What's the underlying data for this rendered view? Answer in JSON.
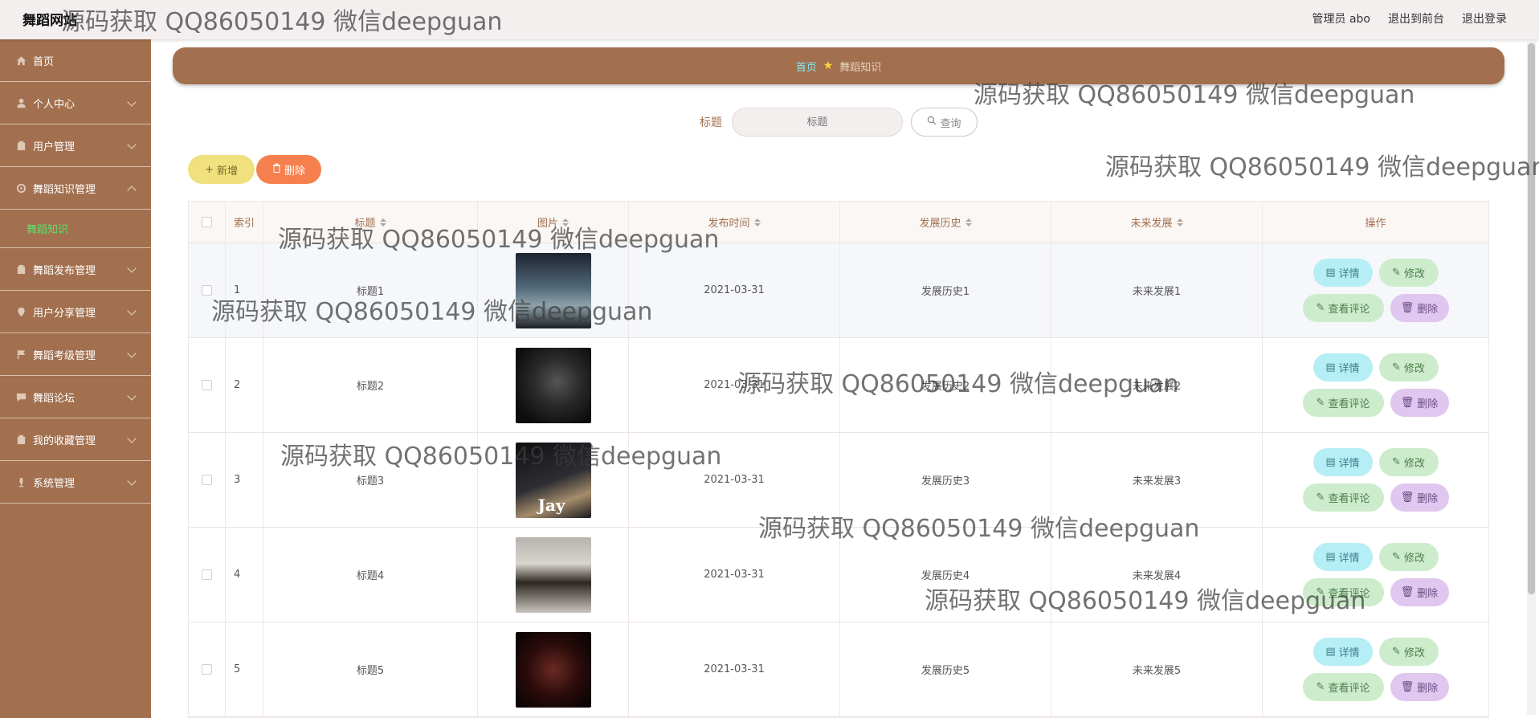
{
  "header": {
    "brand": "舞蹈网站",
    "admin_label": "管理员 abo",
    "back_front_label": "退出到前台",
    "logout_label": "退出登录"
  },
  "sidebar": {
    "items": [
      {
        "label": "首页",
        "icon": "home-icon"
      },
      {
        "label": "个人中心",
        "icon": "user-icon"
      },
      {
        "label": "用户管理",
        "icon": "box-icon"
      },
      {
        "label": "舞蹈知识管理",
        "icon": "gear-icon",
        "expanded": true,
        "children": [
          "舞蹈知识"
        ]
      },
      {
        "label": "舞蹈发布管理",
        "icon": "box-icon"
      },
      {
        "label": "用户分享管理",
        "icon": "location-icon"
      },
      {
        "label": "舞蹈考级管理",
        "icon": "flag-icon"
      },
      {
        "label": "舞蹈论坛",
        "icon": "message-icon"
      },
      {
        "label": "我的收藏管理",
        "icon": "box-icon"
      },
      {
        "label": "系统管理",
        "icon": "mic-icon"
      }
    ],
    "active_child": "舞蹈知识",
    "colors": {
      "bg": "#a3704f",
      "active_child": "#5fe06c"
    }
  },
  "breadcrumb": {
    "home": "首页",
    "current": "舞蹈知识"
  },
  "search": {
    "label": "标题",
    "placeholder": "标题",
    "button": "查询"
  },
  "toolbar": {
    "add_label": "新增",
    "delete_label": "删除"
  },
  "table": {
    "headers": {
      "index": "索引",
      "title": "标题",
      "image": "图片",
      "publish_time": "发布时间",
      "history": "发展历史",
      "future": "未来发展",
      "actions": "操作"
    },
    "rows": [
      {
        "index": "1",
        "title": "标题1",
        "date": "2021-03-31",
        "history": "发展历史1",
        "future": "未来发展1"
      },
      {
        "index": "2",
        "title": "标题2",
        "date": "2021-03-31",
        "history": "发展历史2",
        "future": "未来发展2"
      },
      {
        "index": "3",
        "title": "标题3",
        "date": "2021-03-31",
        "history": "发展历史3",
        "future": "未来发展3",
        "image_text": "Jay"
      },
      {
        "index": "4",
        "title": "标题4",
        "date": "2021-03-31",
        "history": "发展历史4",
        "future": "未来发展4"
      },
      {
        "index": "5",
        "title": "标题5",
        "date": "2021-03-31",
        "history": "发展历史5",
        "future": "未来发展5"
      }
    ],
    "actions": {
      "detail": "详情",
      "edit": "修改",
      "review": "查看评论",
      "remove": "删除"
    }
  },
  "watermark": "源码获取 QQ86050149 微信deepguan"
}
